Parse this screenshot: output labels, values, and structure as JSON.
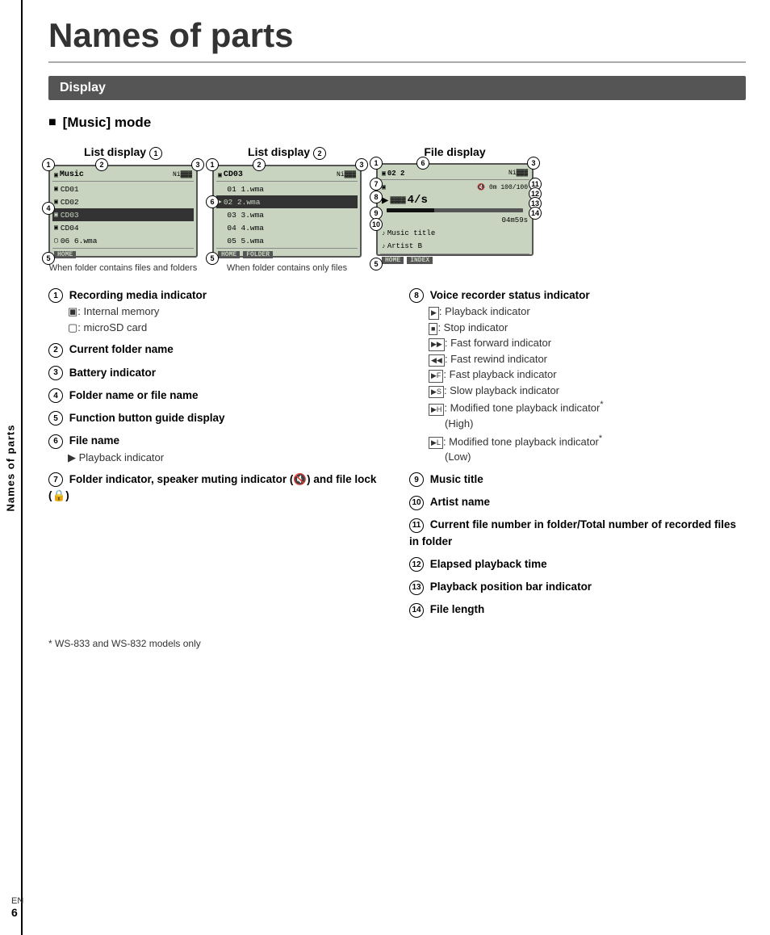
{
  "page": {
    "title": "Names of parts",
    "side_label": "Names of parts",
    "section": "Display",
    "mode_heading": "[Music] mode",
    "page_number": "6",
    "page_lang": "EN",
    "footnote": "* WS-833 and WS-832 models only"
  },
  "displays": {
    "list1": {
      "title": "List display ①",
      "caption": "When folder contains files and folders",
      "rows": [
        {
          "type": "header",
          "text": "Music",
          "icon": "M",
          "battery": "NiCoo"
        },
        {
          "type": "normal",
          "text": "CD01",
          "icon": "folder"
        },
        {
          "type": "normal",
          "text": "CD02",
          "icon": "folder"
        },
        {
          "type": "selected",
          "text": "CD03",
          "icon": "folder"
        },
        {
          "type": "normal",
          "text": "CD04",
          "icon": "folder"
        },
        {
          "type": "normal",
          "text": "06 6.wma",
          "icon": "file"
        },
        {
          "type": "footer",
          "text": "HOME",
          "right": ""
        }
      ]
    },
    "list2": {
      "title": "List display ②",
      "caption": "When folder contains only files",
      "rows": [
        {
          "type": "header",
          "text": "CD03",
          "icon": "M",
          "battery": "NiCoo"
        },
        {
          "type": "normal",
          "text": "01 1.wma",
          "icon": ""
        },
        {
          "type": "selected",
          "text": "02 2.wma",
          "icon": "play"
        },
        {
          "type": "normal",
          "text": "03 3.wma",
          "icon": ""
        },
        {
          "type": "normal",
          "text": "04 4.wma",
          "icon": ""
        },
        {
          "type": "normal",
          "text": "05 5.wma",
          "icon": ""
        },
        {
          "type": "footer",
          "text": "HOME",
          "right": "FOLDER"
        }
      ]
    },
    "file": {
      "title": "File display",
      "rows": [
        {
          "type": "header",
          "text": "02  2",
          "battery": "NiCoo"
        },
        {
          "type": "info",
          "text": "100/100"
        },
        {
          "type": "playback",
          "big": "4/s"
        },
        {
          "type": "time",
          "text": "04m59s"
        },
        {
          "type": "title",
          "text": "Music title"
        },
        {
          "type": "artist",
          "text": "Artist B"
        },
        {
          "type": "footer",
          "text": "HOME",
          "right": "INDEX"
        }
      ]
    }
  },
  "descriptions_left": [
    {
      "num": "1",
      "bold": "Recording media indicator",
      "subs": [
        "🔲: Internal memory",
        "🔲: microSD card"
      ]
    },
    {
      "num": "2",
      "bold": "Current folder name",
      "subs": []
    },
    {
      "num": "3",
      "bold": "Battery indicator",
      "subs": []
    },
    {
      "num": "4",
      "bold": "Folder name or file name",
      "subs": []
    },
    {
      "num": "5",
      "bold": "Function button guide display",
      "subs": []
    },
    {
      "num": "6",
      "bold": "File name",
      "subs": [
        "▶ Playback indicator"
      ]
    },
    {
      "num": "7",
      "bold": "Folder indicator, speaker muting indicator (🔇) and file lock (🔒)",
      "subs": []
    }
  ],
  "descriptions_right": [
    {
      "num": "8",
      "bold": "Voice recorder status indicator",
      "subs": [
        "▶: Playback indicator",
        "⬛: Stop indicator",
        "▶▶: Fast forward indicator",
        "◀◀: Fast rewind indicator",
        "▶: Fast playback indicator",
        "▶: Slow playback indicator",
        "▶: Modified tone playback indicator* (High)",
        "▶: Modified tone playback indicator* (Low)"
      ]
    },
    {
      "num": "9",
      "bold": "Music title",
      "subs": []
    },
    {
      "num": "10",
      "bold": "Artist name",
      "subs": []
    },
    {
      "num": "11",
      "bold": "Current file number in folder/Total number of recorded files in folder",
      "subs": []
    },
    {
      "num": "12",
      "bold": "Elapsed playback time",
      "subs": []
    },
    {
      "num": "13",
      "bold": "Playback position bar indicator",
      "subs": []
    },
    {
      "num": "14",
      "bold": "File length",
      "subs": []
    }
  ],
  "icons": {
    "recording_internal": "🔲",
    "recording_sd": "🔲",
    "playback": "▶",
    "stop": "⬛",
    "fast_forward": "▶▶",
    "fast_rewind": "◀◀"
  }
}
